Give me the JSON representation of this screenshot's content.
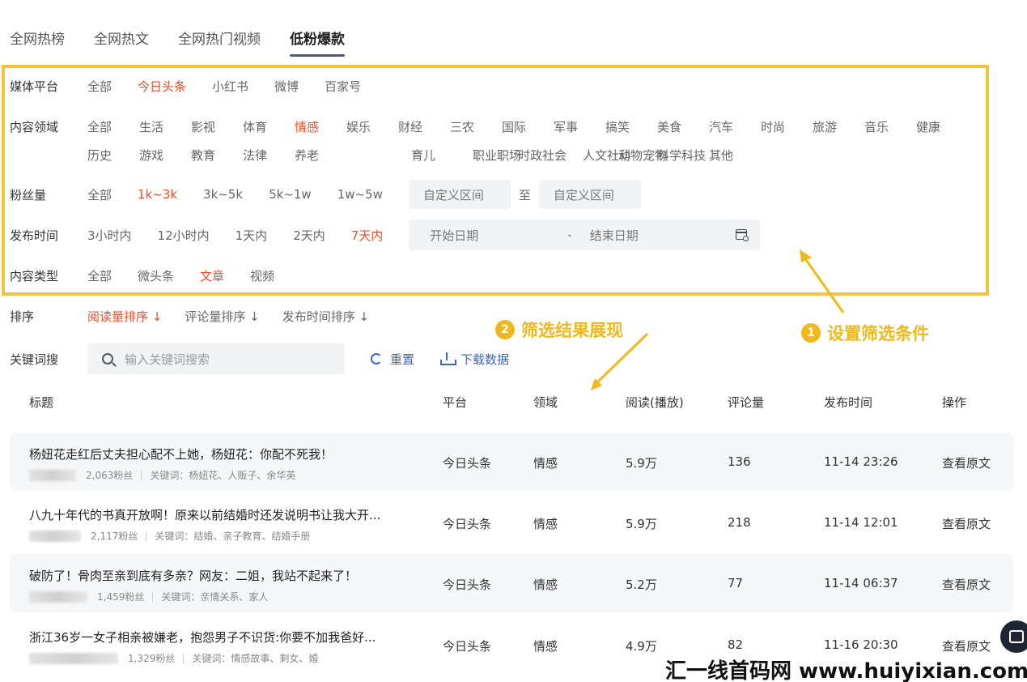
{
  "tabs": [
    "全网热榜",
    "全网热文",
    "全网热门视频",
    "低粉爆款"
  ],
  "filters": {
    "platform": {
      "label": "媒体平台",
      "options": [
        "全部",
        "今日头条",
        "小红书",
        "微博",
        "百家号"
      ],
      "selected": "今日头条"
    },
    "field": {
      "label": "内容领域",
      "options": [
        "全部",
        "生活",
        "影视",
        "体育",
        "情感",
        "娱乐",
        "财经",
        "三农",
        "国际",
        "军事",
        "搞笑",
        "美食",
        "汽车",
        "时尚",
        "旅游",
        "音乐",
        "健康",
        "历史",
        "游戏",
        "教育",
        "法律",
        "养老",
        "育儿",
        "职业职场",
        "时政社会",
        "人文社科",
        "动物宠物",
        "科学科技",
        "其他"
      ],
      "selected": "情感"
    },
    "fans": {
      "label": "粉丝量",
      "options": [
        "全部",
        "1k~3k",
        "3k~5k",
        "5k~1w",
        "1w~5w"
      ],
      "selected": "1k~3k",
      "range_from_placeholder": "自定义区间",
      "range_to_text": "至",
      "range_to_placeholder": "自定义区间"
    },
    "time": {
      "label": "发布时间",
      "options": [
        "3小时内",
        "12小时内",
        "1天内",
        "2天内",
        "7天内"
      ],
      "selected": "7天内",
      "start_placeholder": "开始日期",
      "dash": "-",
      "end_placeholder": "结束日期"
    },
    "type": {
      "label": "内容类型",
      "options": [
        "全部",
        "微头条",
        "文章",
        "视频"
      ],
      "selected": "文章"
    }
  },
  "sort": {
    "label": "排序",
    "options": [
      "阅读量排序 ↓",
      "评论量排序 ↓",
      "发布时间排序 ↓"
    ],
    "selected": "阅读量排序 ↓"
  },
  "keyword": {
    "label": "关键词搜",
    "placeholder": "输入关键词搜索",
    "reset": "重置",
    "download": "下载数据"
  },
  "annotations": {
    "a1": {
      "num": "1",
      "text": "设置筛选条件"
    },
    "a2": {
      "num": "2",
      "text": "筛选结果展现"
    },
    "color": "#f0b81c"
  },
  "table": {
    "headers": {
      "title": "标题",
      "platform": "平台",
      "field": "领域",
      "views": "阅读(播放)",
      "comments": "评论量",
      "time": "发布时间",
      "op": "操作"
    },
    "rows": [
      {
        "title": "杨妞花走红后丈夫担心配不上她，杨妞花：你配不死我！",
        "fans": "2,063粉丝",
        "keywords": "关键词：杨妞花、人贩子、余华英",
        "platform": "今日头条",
        "field": "情感",
        "views": "5.9万",
        "comments": "136",
        "time": "11-14 23:26",
        "op": "查看原文"
      },
      {
        "title": "八九十年代的书真开放啊！原来以前结婚时还发说明书让我大开...",
        "fans": "2,117粉丝",
        "keywords": "关键词：结婚、亲子教育、结婚手册",
        "platform": "今日头条",
        "field": "情感",
        "views": "5.9万",
        "comments": "218",
        "time": "11-14 12:01",
        "op": "查看原文"
      },
      {
        "title": "破防了！骨肉至亲到底有多亲？网友：二姐，我站不起来了！",
        "fans": "1,459粉丝",
        "keywords": "关键词：亲情关系、家人",
        "platform": "今日头条",
        "field": "情感",
        "views": "5.2万",
        "comments": "77",
        "time": "11-14 06:37",
        "op": "查看原文"
      },
      {
        "title": "浙江36岁一女子相亲被嫌老，抱怨男子不识货:你要不加我爸好...",
        "fans": "1,329粉丝",
        "keywords": "关键词：情感故事、剩女、婚",
        "platform": "今日头条",
        "field": "情感",
        "views": "4.9万",
        "comments": "82",
        "time": "11-16 20:30",
        "op": "查看原文"
      }
    ]
  },
  "watermark": "汇一线首码网 www.huiyixian.com",
  "colors": {
    "accent": "#f04b2a",
    "link": "#3a66c6",
    "highlight_border": "#f5c33b"
  }
}
